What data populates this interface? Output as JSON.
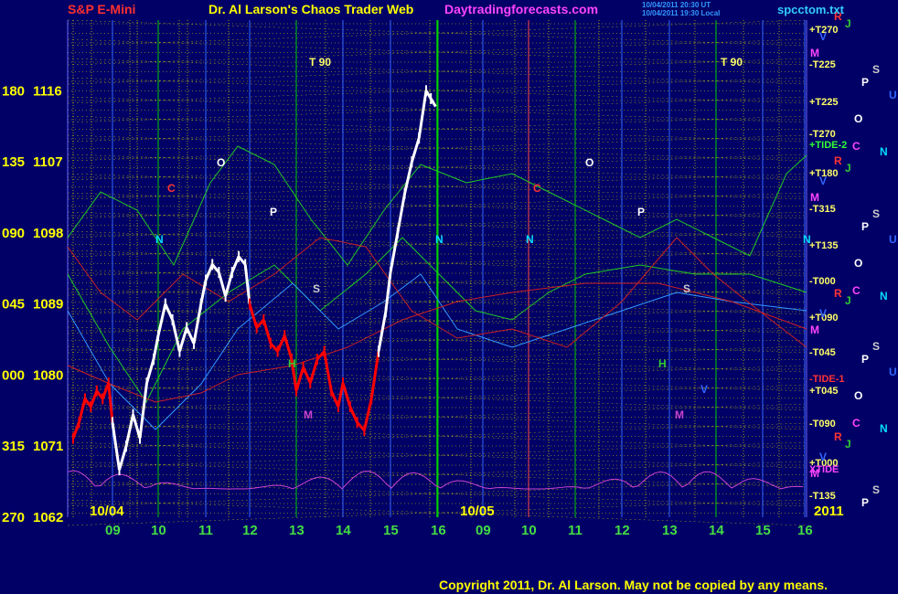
{
  "header": {
    "instrument": "S&P E-Mini",
    "title": "Dr. Al Larson's Chaos Trader Web",
    "site": "Daytradingforecasts.com",
    "stamp1": "10/04/2011 20:30 UT",
    "stamp2": "10/04/2011 19:30 Local",
    "file": "spcctom.txt"
  },
  "copyright": "Copyright 2011, Dr. Al Larson. May not be copied by any means.",
  "colors": {
    "background": "#000066",
    "grid_yellow": "#d8d800",
    "grid_green": "#00cc00",
    "price_white": "#ffffff",
    "price_red": "#ff0000",
    "overlay_green": "#22cc22",
    "overlay_red": "#cc2222",
    "tide_magenta": "#cc44cc",
    "title_yellow": "#ffff00",
    "instrument_red": "#ff3030",
    "site_magenta": "#ff44ff",
    "file_cyan": "#33ccff",
    "axis_yellow": "#ffff00",
    "hour_green": "#44dd44"
  },
  "chart_data": {
    "type": "line",
    "ylim": [
      1062,
      1118
    ],
    "y_ticks": [
      {
        "angle": "180",
        "price": 1116
      },
      {
        "angle": "135",
        "price": 1107
      },
      {
        "angle": "090",
        "price": 1098
      },
      {
        "angle": "045",
        "price": 1089
      },
      {
        "angle": "000",
        "price": 1080
      },
      {
        "angle": "315",
        "price": 1071
      },
      {
        "angle": "270",
        "price": 1062
      }
    ],
    "x_hour_labels": [
      "09",
      "10",
      "11",
      "12",
      "13",
      "14",
      "15",
      "16",
      "09",
      "10",
      "11",
      "12",
      "13",
      "14",
      "15",
      "16"
    ],
    "date_labels": [
      "10/04",
      "10/05",
      "2011"
    ],
    "right_labels": [
      "+T270",
      "-T225",
      "+T225",
      "-T270",
      "+TIDE-2",
      "+T180",
      "-T315",
      "+T135",
      "-T000",
      "+T090",
      "-T045",
      "-TIDE-1",
      "+T045",
      "-T090",
      "+T000",
      "XTIDE",
      "-T135"
    ],
    "planet_glyphs": [
      "R",
      "J",
      "V",
      "M",
      "S",
      "P",
      "U",
      "O",
      "C",
      "N"
    ],
    "chart_glyphs": [
      "T 90",
      "T 90",
      "O",
      "O",
      "P",
      "P",
      "S",
      "S",
      "N",
      "N",
      "N",
      "N",
      "C",
      "C",
      "H",
      "H",
      "M",
      "M",
      "V"
    ],
    "series": [
      {
        "name": "S&P E-Mini",
        "x": [
          0.0,
          0.15,
          0.3,
          0.45,
          0.6,
          0.75,
          0.9,
          1.0,
          1.15,
          1.3,
          1.45,
          1.6,
          1.75,
          1.9,
          2.0,
          2.15,
          2.3,
          2.45,
          2.6,
          2.75,
          2.9,
          3.0,
          3.15,
          3.3,
          3.45,
          3.6,
          3.75,
          3.9,
          4.0,
          4.15,
          4.3,
          4.45,
          4.6,
          4.75,
          4.9,
          5.0,
          5.15,
          5.3,
          5.45,
          5.6,
          5.75,
          5.9,
          6.0,
          6.15,
          6.3,
          6.45,
          6.6,
          6.75,
          6.9,
          7.0,
          7.15,
          7.3,
          7.45,
          7.6,
          7.75,
          7.85,
          7.95
        ],
        "values": [
          1072,
          1074,
          1077,
          1076,
          1078,
          1077,
          1079,
          1074,
          1068,
          1071,
          1075,
          1072,
          1079,
          1082,
          1085,
          1089,
          1087,
          1083,
          1086,
          1084,
          1089,
          1092,
          1094,
          1093,
          1090,
          1093,
          1095,
          1094,
          1089,
          1086,
          1087,
          1084,
          1083,
          1085,
          1082,
          1078,
          1081,
          1079,
          1082,
          1083,
          1078,
          1076,
          1079,
          1076,
          1074,
          1073,
          1077,
          1083,
          1088,
          1093,
          1098,
          1103,
          1107,
          1110,
          1116,
          1115,
          1114
        ]
      }
    ]
  }
}
